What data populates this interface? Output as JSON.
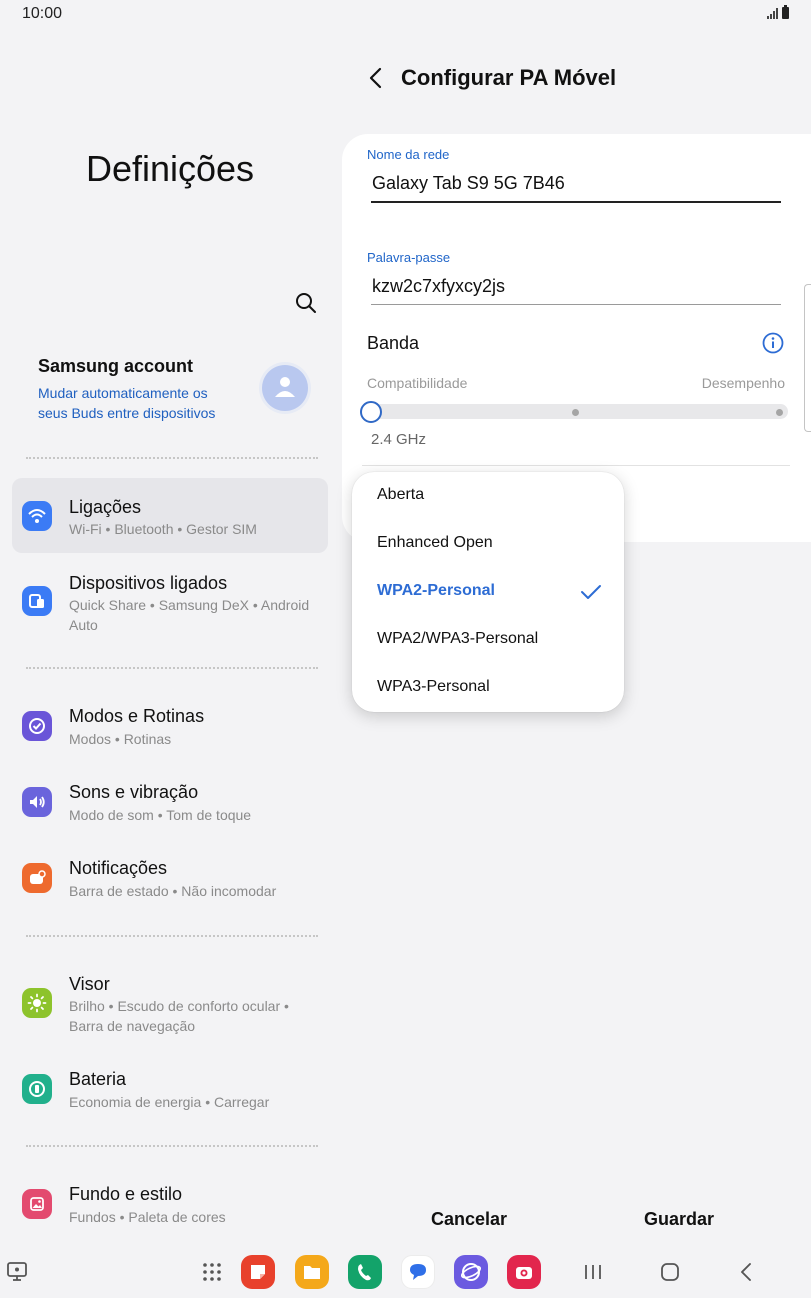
{
  "status_bar": {
    "time": "10:00"
  },
  "left": {
    "title": "Definições",
    "account": {
      "name": "Samsung account",
      "subtitle": "Mudar automaticamente os seus Buds entre dispositivos"
    },
    "menu": [
      {
        "id": "ligacoes",
        "title": "Ligações",
        "subtitle": "Wi-Fi  •  Bluetooth  •  Gestor SIM",
        "icon": "wifi-icon",
        "color": "#3b7bf5"
      },
      {
        "id": "dispositivos",
        "title": "Dispositivos ligados",
        "subtitle": "Quick Share  •  Samsung DeX  •  Android Auto",
        "icon": "devices-icon",
        "color": "#3b7bf5"
      },
      {
        "id": "modos",
        "title": "Modos e Rotinas",
        "subtitle": "Modos  •  Rotinas",
        "icon": "modes-icon",
        "color": "#6a55d8"
      },
      {
        "id": "sons",
        "title": "Sons e vibração",
        "subtitle": "Modo de som  •  Tom de toque",
        "icon": "sound-icon",
        "color": "#6a64dc"
      },
      {
        "id": "notificacoes",
        "title": "Notificações",
        "subtitle": "Barra de estado  •  Não incomodar",
        "icon": "notification-icon",
        "color": "#ee6a2e"
      },
      {
        "id": "visor",
        "title": "Visor",
        "subtitle": "Brilho  •  Escudo de conforto ocular  •  Barra de navegação",
        "icon": "sun-icon",
        "color": "#8dc32c"
      },
      {
        "id": "bateria",
        "title": "Bateria",
        "subtitle": "Economia de energia  •  Carregar",
        "icon": "battery-icon",
        "color": "#21b08c"
      },
      {
        "id": "fundo",
        "title": "Fundo e estilo",
        "subtitle": "Fundos  •  Paleta de cores",
        "icon": "wallpaper-icon",
        "color": "#e34a6f"
      }
    ]
  },
  "right": {
    "title": "Configurar PA Móvel",
    "network_name": {
      "label": "Nome da rede",
      "value": "Galaxy Tab S9 5G 7B46"
    },
    "password": {
      "label": "Palavra-passe",
      "value": "kzw2c7xfyxcy2js"
    },
    "band": {
      "label": "Banda",
      "left_label": "Compatibilidade",
      "right_label": "Desempenho",
      "value": "2.4 GHz",
      "position": 0
    },
    "security_options": [
      "Aberta",
      "Enhanced Open",
      "WPA2-Personal",
      "WPA2/WPA3-Personal",
      "WPA3-Personal"
    ],
    "selected_security": "WPA2-Personal",
    "cancel_label": "Cancelar",
    "save_label": "Guardar"
  },
  "colors": {
    "accent": "#2d6cd4",
    "background": "#f3f3f5",
    "card": "#ffffff"
  }
}
